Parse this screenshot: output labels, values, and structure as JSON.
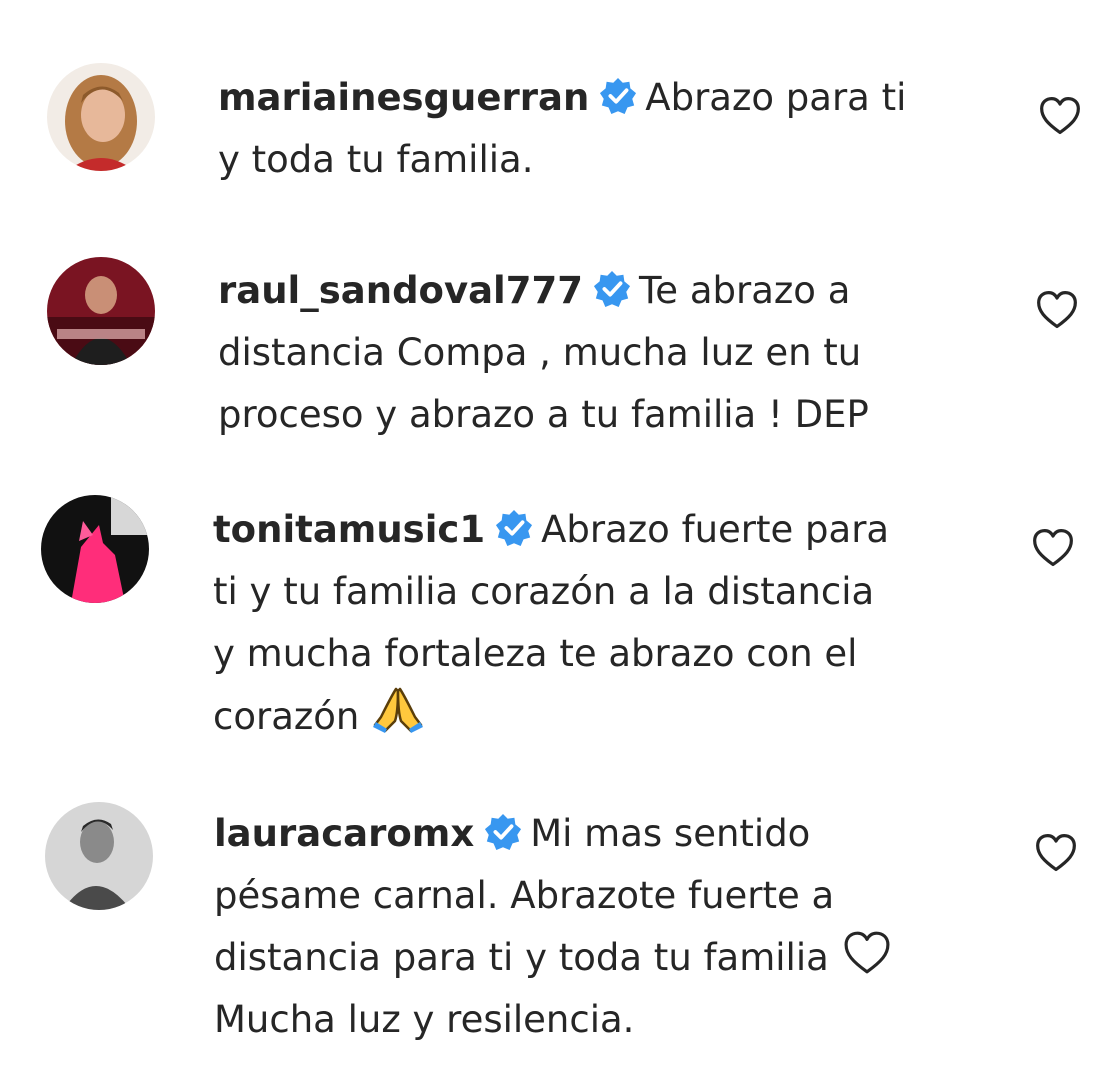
{
  "comments": [
    {
      "username": "mariainesguerran",
      "lines": [
        "Abrazo para ti",
        "y toda tu familia."
      ],
      "avatar_icon": "woman-portrait-avatar",
      "verified": true,
      "liked": false
    },
    {
      "username": "raul_sandoval777",
      "lines": [
        "Te abrazo a",
        "distancia Compa , mucha luz en tu",
        "proceso y abrazo a tu familia ! DEP"
      ],
      "avatar_icon": "man-red-poster-avatar",
      "verified": true,
      "liked": false
    },
    {
      "username": "tonitamusic1",
      "lines": [
        "Abrazo fuerte para",
        "ti y tu familia corazón a la distancia",
        "y mucha fortaleza te abrazo con el",
        "corazón"
      ],
      "emoji": "🙏",
      "emoji_name": "folded-hands-emoji",
      "avatar_icon": "pink-silhouette-avatar",
      "verified": true,
      "liked": false
    },
    {
      "username": "lauracaromx",
      "lines": [
        "Mi mas sentido",
        "pésame carnal. Abrazote fuerte a",
        "distancia para ti y toda tu familia",
        "Mucha luz y resilencia."
      ],
      "inline_icon": "outline-heart-icon",
      "avatar_icon": "grayscale-portrait-avatar",
      "verified": true,
      "liked": false
    }
  ],
  "colors": {
    "text": "#262626",
    "verified_blue": "#3897f0",
    "heart_outline": "#262626"
  }
}
